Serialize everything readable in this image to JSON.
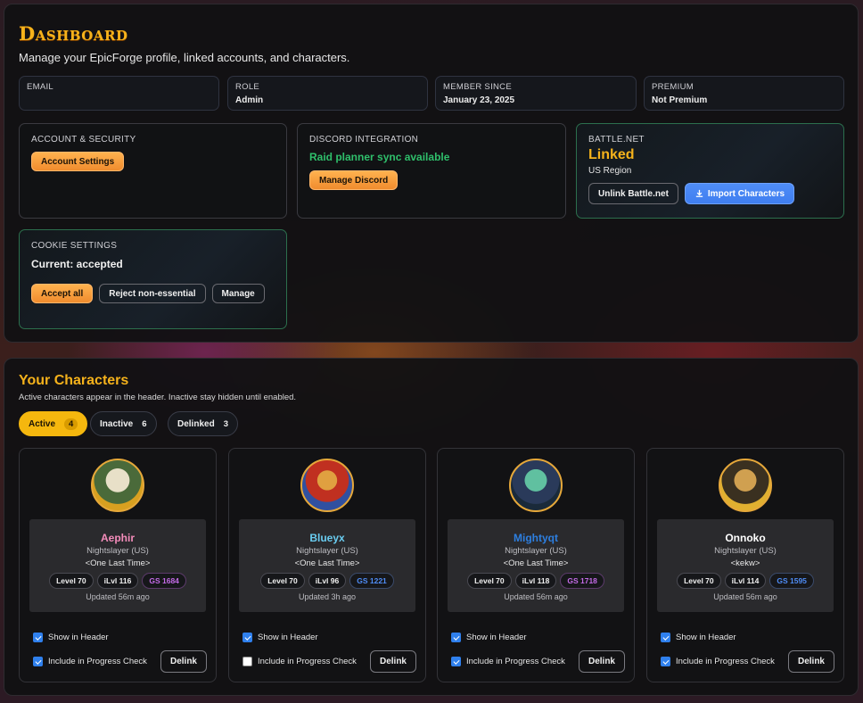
{
  "dashboard": {
    "title": "Dashboard",
    "subtitle": "Manage your EpicForge profile, linked accounts, and characters.",
    "info": [
      {
        "label": "EMAIL",
        "value": ""
      },
      {
        "label": "ROLE",
        "value": "Admin"
      },
      {
        "label": "MEMBER SINCE",
        "value": "January 23, 2025"
      },
      {
        "label": "PREMIUM",
        "value": "Not Premium"
      }
    ],
    "account": {
      "label": "ACCOUNT & SECURITY",
      "button": "Account Settings"
    },
    "discord": {
      "label": "DISCORD INTEGRATION",
      "status": "Raid planner sync available",
      "button": "Manage Discord"
    },
    "battlenet": {
      "label": "BATTLE.NET",
      "status": "Linked",
      "region": "US Region",
      "unlink": "Unlink Battle.net",
      "import": "Import Characters"
    },
    "cookies": {
      "label": "COOKIE SETTINGS",
      "current": "Current: accepted",
      "accept": "Accept all",
      "reject": "Reject non-essential",
      "manage": "Manage"
    }
  },
  "characters": {
    "title": "Your Characters",
    "subtitle": "Active characters appear in the header. Inactive stay hidden until enabled.",
    "tabs": [
      {
        "label": "Active",
        "count": "4"
      },
      {
        "label": "Inactive",
        "count": "6"
      },
      {
        "label": "Delinked",
        "count": "3"
      }
    ],
    "show_header_label": "Show in Header",
    "progress_label": "Include in Progress Check",
    "delink_label": "Delink",
    "list": [
      {
        "name": "Aephir",
        "name_color": "#f48cba",
        "realm": "Nightslayer (US)",
        "guild": "<One Last Time>",
        "level": "Level 70",
        "ilvl": "iLvl 116",
        "gs": "GS 1684",
        "gs_color": "purple",
        "updated": "Updated 56m ago",
        "show_header": true,
        "progress": true
      },
      {
        "name": "Blueyx",
        "name_color": "#69ccf0",
        "realm": "Nightslayer (US)",
        "guild": "<One Last Time>",
        "level": "Level 70",
        "ilvl": "iLvl 96",
        "gs": "GS 1221",
        "gs_color": "blue",
        "updated": "Updated 3h ago",
        "show_header": true,
        "progress": false
      },
      {
        "name": "Mightyqt",
        "name_color": "#2d7fe0",
        "realm": "Nightslayer (US)",
        "guild": "<One Last Time>",
        "level": "Level 70",
        "ilvl": "iLvl 118",
        "gs": "GS 1718",
        "gs_color": "purple",
        "updated": "Updated 56m ago",
        "show_header": true,
        "progress": true
      },
      {
        "name": "Onnoko",
        "name_color": "#ffffff",
        "realm": "Nightslayer (US)",
        "guild": "<kekw>",
        "level": "Level 70",
        "ilvl": "iLvl 114",
        "gs": "GS 1595",
        "gs_color": "blue",
        "updated": "Updated 56m ago",
        "show_header": true,
        "progress": true
      }
    ]
  }
}
